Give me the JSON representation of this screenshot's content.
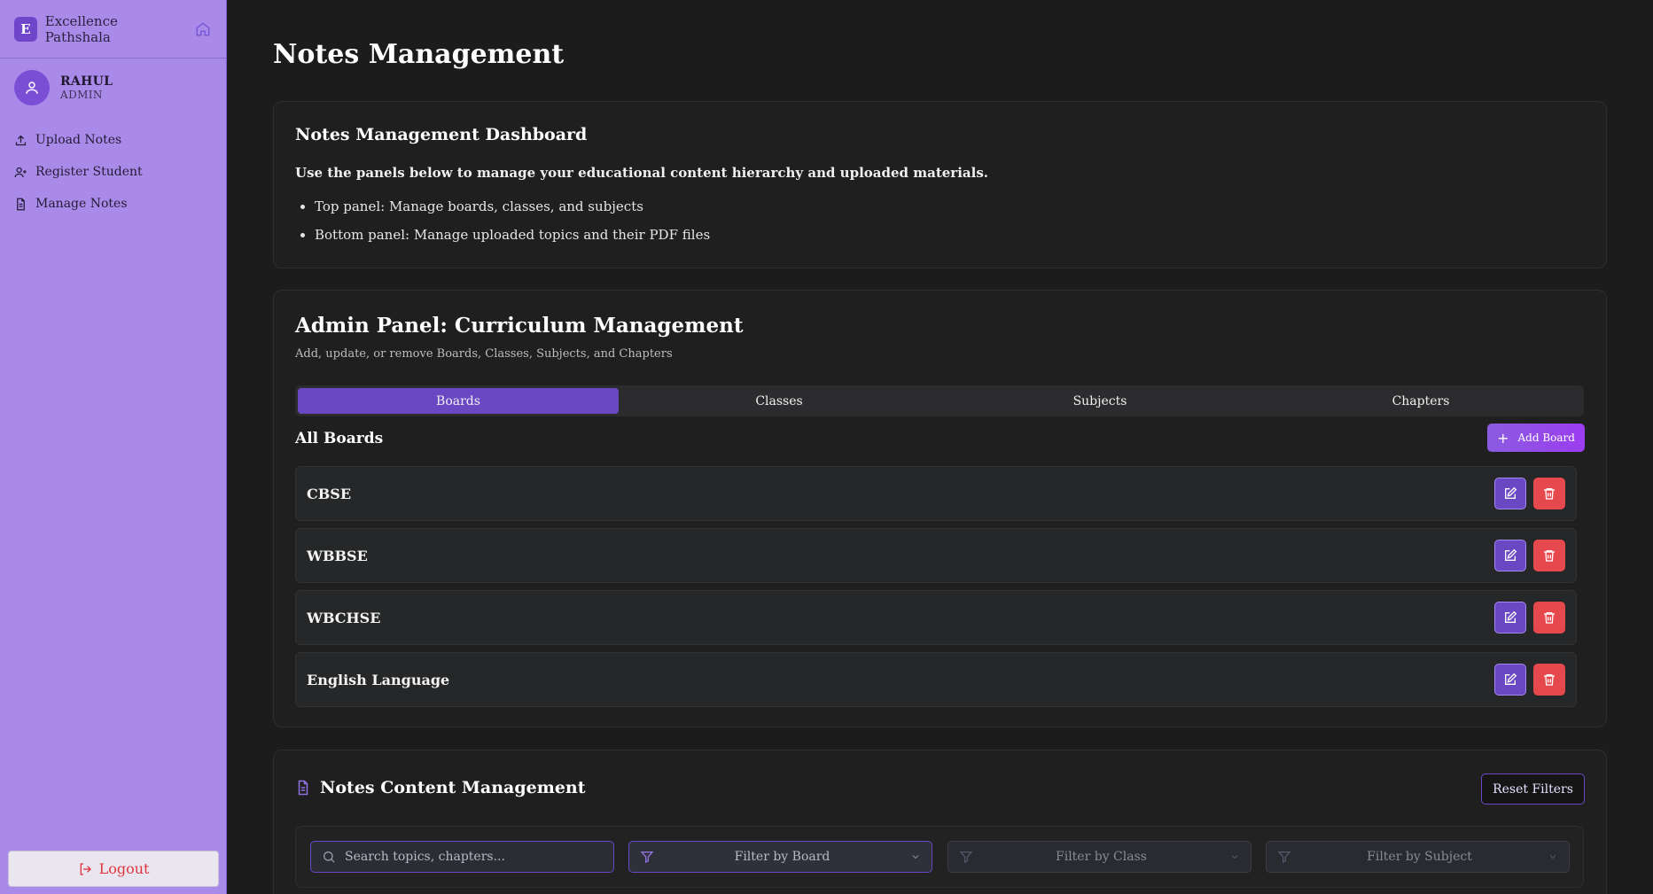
{
  "sidebar": {
    "brand_initial": "E",
    "brand_name": "Excellence Pathshala",
    "user_name": "RAHUL",
    "user_role": "ADMIN",
    "nav": [
      {
        "label": "Upload Notes",
        "icon": "upload-icon"
      },
      {
        "label": "Register Student",
        "icon": "user-plus-icon"
      },
      {
        "label": "Manage Notes",
        "icon": "file-text-icon"
      }
    ],
    "logout_label": "Logout"
  },
  "main": {
    "page_title": "Notes Management",
    "dashboard": {
      "title": "Notes Management Dashboard",
      "lead": "Use the panels below to manage your educational content hierarchy and uploaded materials.",
      "bullets": [
        "Top panel: Manage boards, classes, and subjects",
        "Bottom panel: Manage uploaded topics and their PDF files"
      ]
    },
    "admin_panel": {
      "title": "Admin Panel: Curriculum Management",
      "subtitle": "Add, update, or remove Boards, Classes, Subjects, and Chapters",
      "tabs": [
        "Boards",
        "Classes",
        "Subjects",
        "Chapters"
      ],
      "active_tab": "Boards",
      "list_title": "All Boards",
      "add_label": "Add Board",
      "boards": [
        "CBSE",
        "WBBSE",
        "WBCHSE",
        "English Language"
      ]
    },
    "notes_content": {
      "title": "Notes Content Management",
      "reset_label": "Reset Filters",
      "search_placeholder": "Search topics, chapters...",
      "filters": [
        "Filter by Board",
        "Filter by Class",
        "Filter by Subject"
      ]
    }
  },
  "colors": {
    "sidebar_bg": "#a98ae8",
    "accent": "#6a48c4",
    "danger": "#e5484d",
    "background": "#1c1c1c"
  }
}
